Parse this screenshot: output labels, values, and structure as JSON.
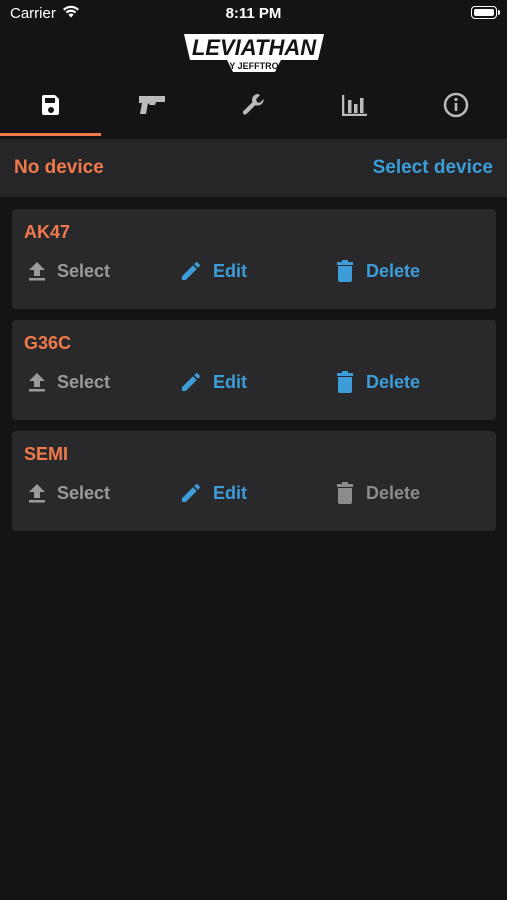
{
  "status_bar": {
    "carrier": "Carrier",
    "time": "8:11 PM"
  },
  "logo": {
    "main": "LEVIATHAN",
    "sub": "BY JEFFTRON"
  },
  "tabs": [
    {
      "icon": "save-icon",
      "active": true
    },
    {
      "icon": "gun-icon",
      "active": false
    },
    {
      "icon": "wrench-icon",
      "active": false
    },
    {
      "icon": "bar-chart-icon",
      "active": false
    },
    {
      "icon": "info-icon",
      "active": false
    }
  ],
  "device_bar": {
    "status": "No device",
    "select_label": "Select device"
  },
  "profiles": [
    {
      "name": "AK47",
      "select_label": "Select",
      "edit_label": "Edit",
      "delete_label": "Delete",
      "delete_enabled": true
    },
    {
      "name": "G36C",
      "select_label": "Select",
      "edit_label": "Edit",
      "delete_label": "Delete",
      "delete_enabled": true
    },
    {
      "name": "SEMI",
      "select_label": "Select",
      "edit_label": "Edit",
      "delete_label": "Delete",
      "delete_enabled": false
    }
  ],
  "colors": {
    "accent_orange": "#f07a4b",
    "accent_blue": "#3c9dd8",
    "disabled_gray": "#8c8c8c"
  }
}
